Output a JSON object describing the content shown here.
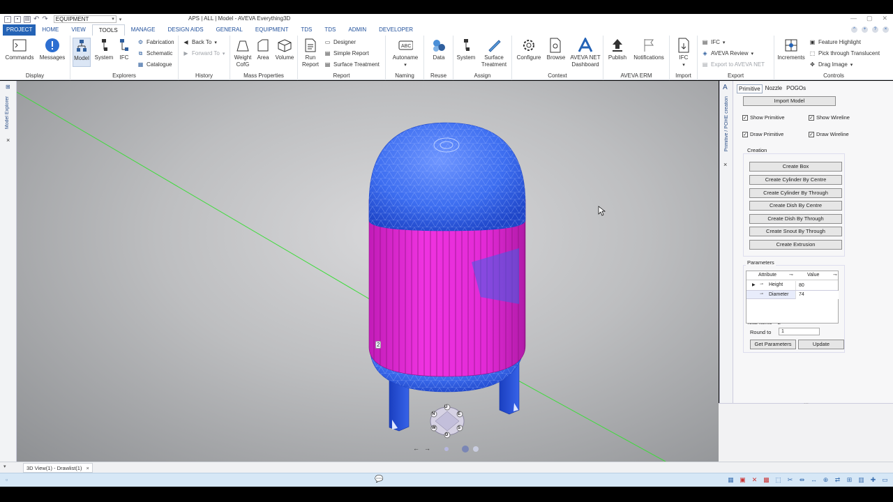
{
  "title": {
    "window_title": "APS | ALL | Model - AVEVA Everything3D",
    "module_combo": "EQUIPMENT"
  },
  "tabs": [
    "PROJECT",
    "HOME",
    "VIEW",
    "TOOLS",
    "MANAGE",
    "DESIGN AIDS",
    "GENERAL",
    "EQUIPMENT",
    "TDS",
    "TDS",
    "ADMIN",
    "DEVELOPER"
  ],
  "active_tab": "TOOLS",
  "ribbon": {
    "display": {
      "label": "Display",
      "commands": "Commands",
      "messages": "Messages"
    },
    "explorers": {
      "label": "Explorers",
      "model": "Model",
      "system": "System",
      "ifc": "IFC",
      "fabrication": "Fabrication",
      "schematic": "Schematic",
      "catalogue": "Catalogue"
    },
    "history": {
      "label": "History",
      "back_to": "Back To",
      "forward_to": "Forward To"
    },
    "mass": {
      "label": "Mass Properties",
      "weight": "Weight",
      "cofg": "CofG",
      "area": "Area",
      "volume": "Volume"
    },
    "report": {
      "label": "Report",
      "run": "Run",
      "run2": "Report",
      "designer": "Designer",
      "simple": "Simple Report",
      "surface_treatment": "Surface Treatment"
    },
    "naming": {
      "label": "Naming",
      "autoname": "Autoname"
    },
    "reuse": {
      "label": "Reuse",
      "data": "Data"
    },
    "assign": {
      "label": "Assign",
      "system": "System",
      "surface": "Surface",
      "treatment": "Treatment"
    },
    "context": {
      "label": "Context",
      "configure": "Configure",
      "browse": "Browse",
      "aveva_net": "AVEVA NET",
      "dashboard": "Dashboard"
    },
    "erm": {
      "label": "AVEVA ERM",
      "publish": "Publish",
      "notifications": "Notifications"
    },
    "import": {
      "label": "Import",
      "ifc": "IFC"
    },
    "export": {
      "label": "Export",
      "ifc": "IFC",
      "aveva_review": "AVEVA Review",
      "export_net": "Export to AVEVA NET"
    },
    "controls": {
      "label": "Controls",
      "increments": "Increments",
      "feature_highlight": "Feature Highlight",
      "pick_translucent": "Pick through Translucent",
      "drag_image": "Drag Image"
    }
  },
  "left_strip": {
    "model_explorer": "Model Explorer"
  },
  "right_strip": {
    "primitive_creation": "Primitive / POHE creation"
  },
  "panel": {
    "tabs": [
      "Primitive",
      "Nozzle",
      "POGOs"
    ],
    "import_model": "Import Model",
    "show_primitive": "Show Primitive",
    "show_wireline": "Show Wireline",
    "draw_primitive": "Draw Primitive",
    "draw_wireline": "Draw Wireline",
    "creation_label": "Creation",
    "create_buttons": [
      "Create Box",
      "Create Cylinder By Centre",
      "Create Cylinder By Through",
      "Create Dish By Centre",
      "Create Dish By Through",
      "Create Snout By Through",
      "Create Extrusion"
    ],
    "parameters_label": "Parameters",
    "grid_headers": {
      "attribute": "Attribute",
      "value": "Value"
    },
    "rows": [
      {
        "attribute": "Height",
        "value": "80"
      },
      {
        "attribute": "Diameter",
        "value": "74"
      }
    ],
    "total_items": "Total Items = 2",
    "round_to_label": "Round to",
    "round_to_value": "1",
    "get_parameters": "Get Parameters",
    "update": "Update"
  },
  "viewcube_letters": {
    "up": "U",
    "north": "N",
    "east": "E",
    "south": "S",
    "west": "W",
    "down": "D"
  },
  "badge_number": "2",
  "doc_tab": "3D View(1) - Drawlist(1)",
  "colors": {
    "vessel_top": "#3d6ef0",
    "vessel_body": "#e22ad6",
    "accent": "#2463b6",
    "status": "#d6e7f6"
  }
}
